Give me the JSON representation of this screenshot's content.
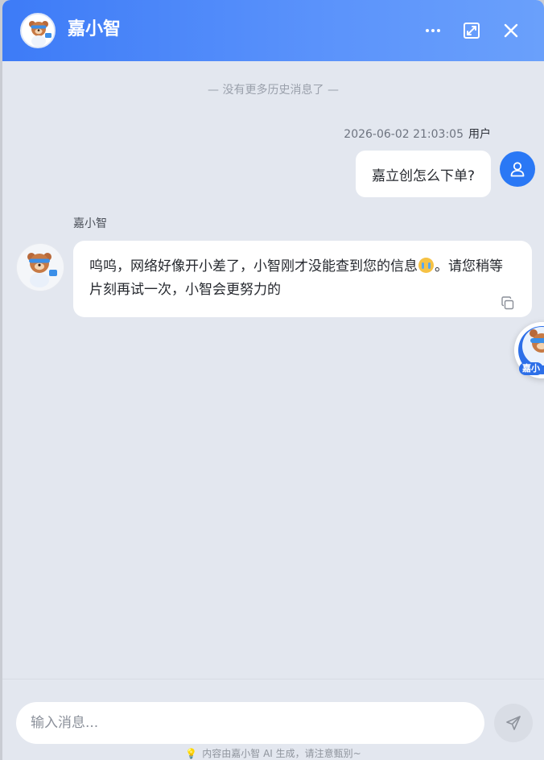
{
  "header": {
    "title": "嘉小智",
    "more_icon": "more-horizontal-icon",
    "expand_icon": "expand-icon",
    "close_icon": "close-icon",
    "colors": {
      "start": "#3d7bf7",
      "end": "#6aa0fb"
    }
  },
  "history_note": "— 没有更多历史消息了 —",
  "messages": [
    {
      "role": "user",
      "timestamp": "2026-06-02 21:03:05",
      "sender": "用户",
      "text": "嘉立创怎么下单?",
      "avatar_icon": "user-icon"
    },
    {
      "role": "bot",
      "sender": "嘉小智",
      "text_before_emoji": "呜呜，网络好像开小差了，小智刚才没能查到您的信息",
      "emoji": "crying-face-emoji",
      "text_after_emoji": "。请您稍等片刻再试一次，小智会更努力的",
      "copy_icon": "copy-icon"
    }
  ],
  "floating_assistant": {
    "label": "嘉小"
  },
  "composer": {
    "placeholder": "输入消息...",
    "send_icon": "send-icon",
    "disclaimer": "内容由嘉小智 AI 生成，请注意甄别~",
    "disclaimer_icon": "lightbulb-icon"
  },
  "colors": {
    "accent": "#2a78f5",
    "background": "#e3e7ef",
    "bubble": "#ffffff"
  }
}
